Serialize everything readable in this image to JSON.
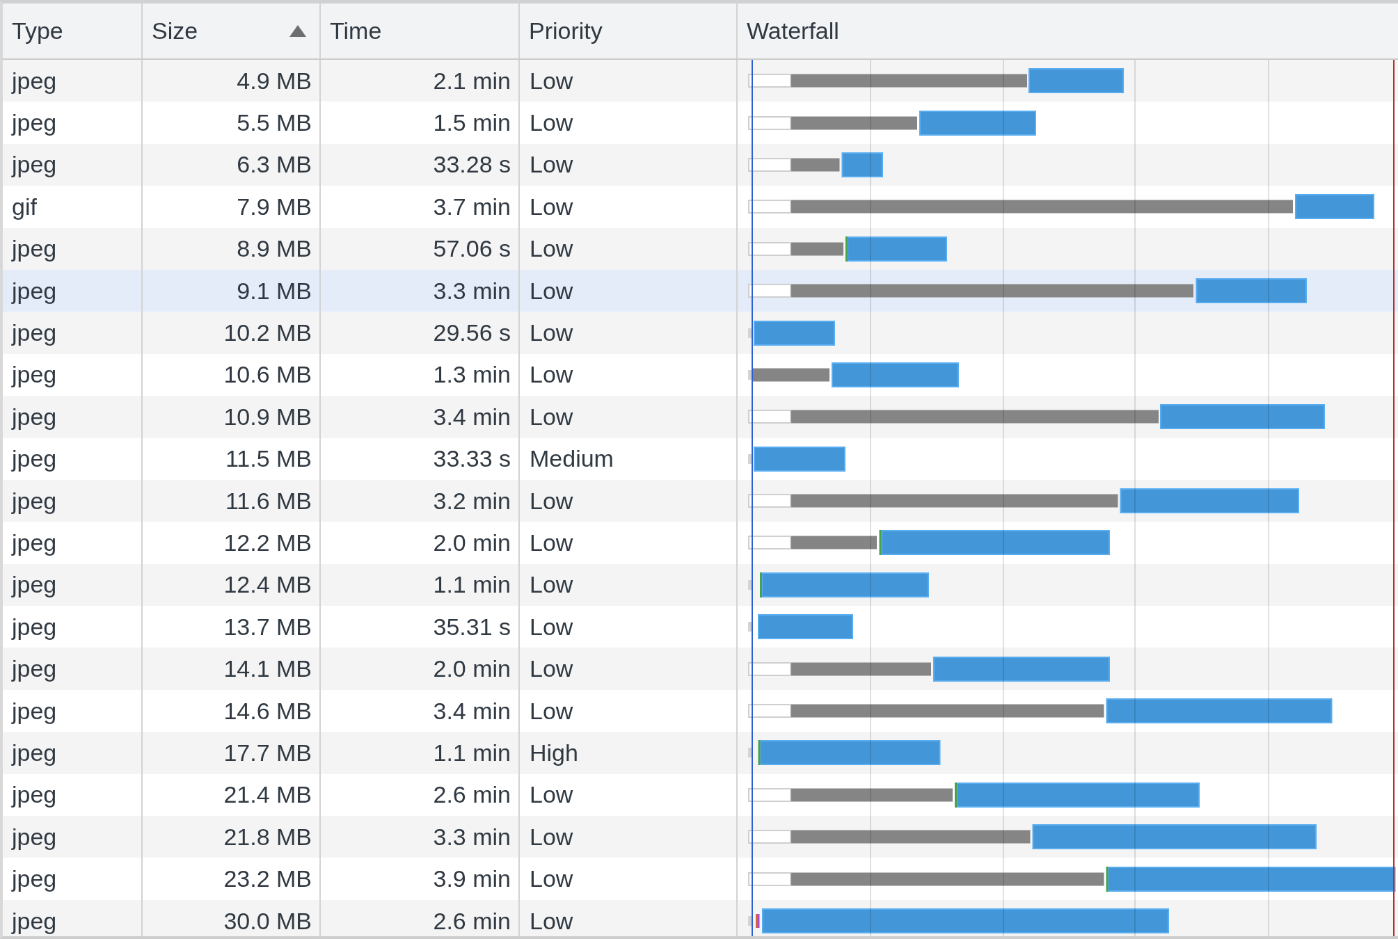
{
  "columns": [
    {
      "label": "Type",
      "sorted": false
    },
    {
      "label": "Size",
      "sorted": true
    },
    {
      "label": "Time",
      "sorted": false
    },
    {
      "label": "Priority",
      "sorted": false
    },
    {
      "label": "Waterfall",
      "sorted": false
    }
  ],
  "rows": [
    {
      "type": "jpeg",
      "size": "4.9 MB",
      "time": "2.1 min",
      "priority": "Low",
      "hovered": false
    },
    {
      "type": "jpeg",
      "size": "5.5 MB",
      "time": "1.5 min",
      "priority": "Low",
      "hovered": false
    },
    {
      "type": "jpeg",
      "size": "6.3 MB",
      "time": "33.28 s",
      "priority": "Low",
      "hovered": false
    },
    {
      "type": "gif",
      "size": "7.9 MB",
      "time": "3.7 min",
      "priority": "Low",
      "hovered": false
    },
    {
      "type": "jpeg",
      "size": "8.9 MB",
      "time": "57.06 s",
      "priority": "Low",
      "hovered": false
    },
    {
      "type": "jpeg",
      "size": "9.1 MB",
      "time": "3.3 min",
      "priority": "Low",
      "hovered": true
    },
    {
      "type": "jpeg",
      "size": "10.2 MB",
      "time": "29.56 s",
      "priority": "Low",
      "hovered": false
    },
    {
      "type": "jpeg",
      "size": "10.6 MB",
      "time": "1.3 min",
      "priority": "Low",
      "hovered": false
    },
    {
      "type": "jpeg",
      "size": "10.9 MB",
      "time": "3.4 min",
      "priority": "Low",
      "hovered": false
    },
    {
      "type": "jpeg",
      "size": "11.5 MB",
      "time": "33.33 s",
      "priority": "Medium",
      "hovered": false
    },
    {
      "type": "jpeg",
      "size": "11.6 MB",
      "time": "3.2 min",
      "priority": "Low",
      "hovered": false
    },
    {
      "type": "jpeg",
      "size": "12.2 MB",
      "time": "2.0 min",
      "priority": "Low",
      "hovered": false
    },
    {
      "type": "jpeg",
      "size": "12.4 MB",
      "time": "1.1 min",
      "priority": "Low",
      "hovered": false
    },
    {
      "type": "jpeg",
      "size": "13.7 MB",
      "time": "35.31 s",
      "priority": "Low",
      "hovered": false
    },
    {
      "type": "jpeg",
      "size": "14.1 MB",
      "time": "2.0 min",
      "priority": "Low",
      "hovered": false
    },
    {
      "type": "jpeg",
      "size": "14.6 MB",
      "time": "3.4 min",
      "priority": "Low",
      "hovered": false
    },
    {
      "type": "jpeg",
      "size": "17.7 MB",
      "time": "1.1 min",
      "priority": "High",
      "hovered": false
    },
    {
      "type": "jpeg",
      "size": "21.4 MB",
      "time": "2.6 min",
      "priority": "Low",
      "hovered": false
    },
    {
      "type": "jpeg",
      "size": "21.8 MB",
      "time": "3.3 min",
      "priority": "Low",
      "hovered": false
    },
    {
      "type": "jpeg",
      "size": "23.2 MB",
      "time": "3.9 min",
      "priority": "Low",
      "hovered": false
    },
    {
      "type": "jpeg",
      "size": "30.0 MB",
      "time": "2.6 min",
      "priority": "Low",
      "hovered": false
    }
  ]
}
